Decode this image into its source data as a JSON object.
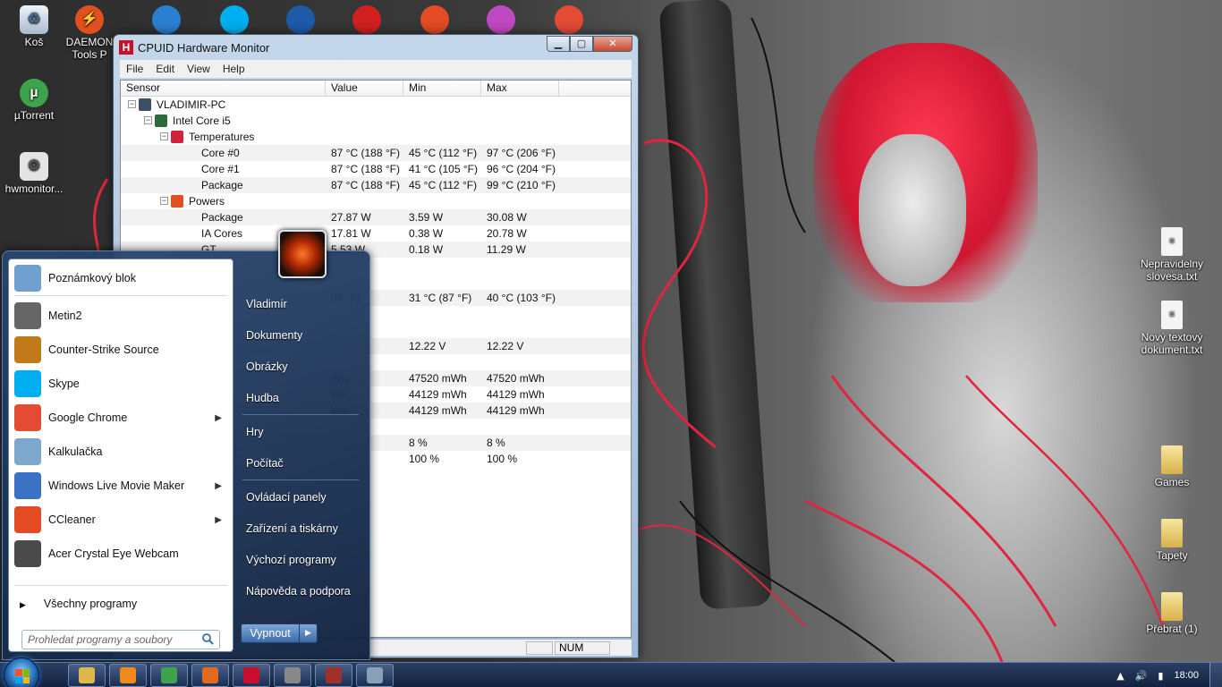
{
  "desktop": {
    "icons_left": [
      {
        "label": "Koš",
        "icon": "recycle-bin-icon",
        "color": "#c7d5e6"
      },
      {
        "label": "DAEMON Tools P",
        "icon": "daemon-tools-icon",
        "color": "#e2501f"
      },
      {
        "label": "µTorrent",
        "icon": "utorrent-icon",
        "color": "#3fa34d"
      },
      {
        "label": "hwmonitor...",
        "icon": "settings-file-icon",
        "color": "#d8d8d8"
      }
    ],
    "icons_top": [
      {
        "icon": "nero-icon",
        "color": "#2a7fd1"
      },
      {
        "icon": "skype-icon",
        "color": "#00aff0"
      },
      {
        "icon": "media-player-icon",
        "color": "#1e5aa8"
      },
      {
        "icon": "flash-icon",
        "color": "#d02020"
      },
      {
        "icon": "ccleaner-icon",
        "color": "#e34b24"
      },
      {
        "icon": "picasa-icon",
        "color": "#c048c0"
      },
      {
        "icon": "chrome-icon",
        "color": "#e34b35"
      }
    ],
    "icons_right": [
      {
        "label": "Nepravidelny slovesa.txt",
        "icon": "text-file-icon"
      },
      {
        "label": "Nový textový dokument.txt",
        "icon": "text-file-icon"
      },
      {
        "label": "Games",
        "icon": "folder-icon"
      },
      {
        "label": "Tapety",
        "icon": "folder-icon"
      },
      {
        "label": "Přebrat (1)",
        "icon": "folder-icon"
      }
    ]
  },
  "hwmonitor": {
    "title": "CPUID Hardware Monitor",
    "menu": [
      "File",
      "Edit",
      "View",
      "Help"
    ],
    "columns": [
      "Sensor",
      "Value",
      "Min",
      "Max"
    ],
    "rows": [
      {
        "level": 0,
        "name": "VLADIMIR-PC",
        "value": "",
        "min": "",
        "max": "",
        "node": "computer"
      },
      {
        "level": 1,
        "name": "Intel Core i5",
        "value": "",
        "min": "",
        "max": "",
        "node": "cpu"
      },
      {
        "level": 2,
        "name": "Temperatures",
        "value": "",
        "min": "",
        "max": "",
        "node": "thermometer"
      },
      {
        "level": 3,
        "name": "Core #0",
        "value": "87 °C  (188 °F)",
        "min": "45 °C  (112 °F)",
        "max": "97 °C  (206 °F)",
        "alt": true
      },
      {
        "level": 3,
        "name": "Core #1",
        "value": "87 °C  (188 °F)",
        "min": "41 °C  (105 °F)",
        "max": "96 °C  (204 °F)"
      },
      {
        "level": 3,
        "name": "Package",
        "value": "87 °C  (188 °F)",
        "min": "45 °C  (112 °F)",
        "max": "99 °C  (210 °F)",
        "alt": true
      },
      {
        "level": 2,
        "name": "Powers",
        "value": "",
        "min": "",
        "max": "",
        "node": "flame"
      },
      {
        "level": 3,
        "name": "Package",
        "value": "27.87 W",
        "min": "3.59 W",
        "max": "30.08 W",
        "alt": true
      },
      {
        "level": 3,
        "name": "IA Cores",
        "value": "17.81 W",
        "min": "0.38 W",
        "max": "20.78 W"
      },
      {
        "level": 3,
        "name": "GT",
        "value": "5.53 W",
        "min": "0.18 W",
        "max": "11.29 W",
        "alt": true
      },
      {
        "level": 3,
        "name": "",
        "value": "",
        "min": "",
        "max": ""
      },
      {
        "level": 3,
        "name": "",
        "value": "",
        "min": "",
        "max": ""
      },
      {
        "level": 3,
        "name": "",
        "value": "03 °F)",
        "min": "31 °C  (87 °F)",
        "max": "40 °C  (103 °F)",
        "alt": true
      },
      {
        "level": 3,
        "name": "",
        "value": "",
        "min": "",
        "max": ""
      },
      {
        "level": 3,
        "name": "",
        "value": "",
        "min": "",
        "max": ""
      },
      {
        "level": 3,
        "name": "",
        "value": "",
        "min": "12.22 V",
        "max": "12.22 V",
        "alt": true
      },
      {
        "level": 3,
        "name": "",
        "value": "",
        "min": "",
        "max": ""
      },
      {
        "level": 3,
        "name": "",
        "value": "Wh",
        "min": "47520 mWh",
        "max": "47520 mWh",
        "alt": true
      },
      {
        "level": 3,
        "name": "",
        "value": "Wh",
        "min": "44129 mWh",
        "max": "44129 mWh"
      },
      {
        "level": 3,
        "name": "",
        "value": "Wh",
        "min": "44129 mWh",
        "max": "44129 mWh",
        "alt": true
      },
      {
        "level": 3,
        "name": "",
        "value": "",
        "min": "",
        "max": ""
      },
      {
        "level": 3,
        "name": "",
        "value": "",
        "min": "8 %",
        "max": "8 %",
        "alt": true
      },
      {
        "level": 3,
        "name": "",
        "value": "",
        "min": "100 %",
        "max": "100 %"
      }
    ],
    "status_num": "NUM"
  },
  "start_menu": {
    "programs": [
      {
        "label": "Poznámkový blok",
        "icon": "notepad-icon",
        "color": "#6fa0d0",
        "arrow": false
      },
      {
        "label": "Metin2",
        "icon": "metin2-icon",
        "color": "#666666",
        "arrow": false
      },
      {
        "label": "Counter-Strike Source",
        "icon": "counter-strike-icon",
        "color": "#c07a1a",
        "arrow": false
      },
      {
        "label": "Skype",
        "icon": "skype-icon",
        "color": "#00aff0",
        "arrow": false
      },
      {
        "label": "Google Chrome",
        "icon": "chrome-icon",
        "color": "#e34b35",
        "arrow": true
      },
      {
        "label": "Kalkulačka",
        "icon": "calculator-icon",
        "color": "#7ea7cc",
        "arrow": false
      },
      {
        "label": "Windows Live Movie Maker",
        "icon": "movie-maker-icon",
        "color": "#3b73c4",
        "arrow": true
      },
      {
        "label": "CCleaner",
        "icon": "ccleaner-icon",
        "color": "#e34b24",
        "arrow": true
      },
      {
        "label": "Acer Crystal Eye Webcam",
        "icon": "webcam-icon",
        "color": "#4a4a4a",
        "arrow": false
      }
    ],
    "all_programs": "Všechny programy",
    "search_placeholder": "Prohledat programy a soubory",
    "right_links_group1": [
      "Vladimír",
      "Dokumenty",
      "Obrázky",
      "Hudba"
    ],
    "right_links_group2": [
      "Hry",
      "Počítač"
    ],
    "right_links_group3": [
      "Ovládací panely",
      "Zařízení a tiskárny",
      "Výchozí programy",
      "Nápověda a podpora"
    ],
    "shutdown": "Vypnout"
  },
  "taskbar": {
    "buttons": [
      {
        "icon": "explorer-icon",
        "color": "#e0b84a"
      },
      {
        "icon": "media-player-icon",
        "color": "#f08a1a"
      },
      {
        "icon": "utorrent-icon",
        "color": "#3fa34d"
      },
      {
        "icon": "firefox-icon",
        "color": "#e36a1c"
      },
      {
        "icon": "hwmonitor-icon",
        "color": "#c8102e"
      },
      {
        "icon": "metin2-icon",
        "color": "#888888"
      },
      {
        "icon": "game-icon",
        "color": "#a0302a"
      },
      {
        "icon": "tool-icon",
        "color": "#8aa0b8"
      }
    ],
    "clock": "18:00"
  }
}
